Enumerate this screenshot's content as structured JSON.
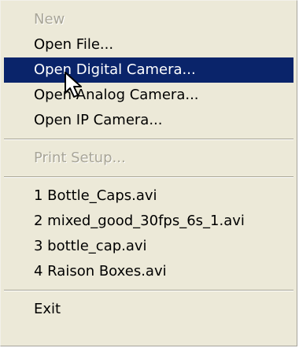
{
  "menu": {
    "items": [
      {
        "label": "New",
        "enabled": false
      },
      {
        "label": "Open File...",
        "enabled": true
      },
      {
        "label": "Open Digital Camera...",
        "enabled": true,
        "highlighted": true
      },
      {
        "label": "Open Analog Camera...",
        "enabled": true
      },
      {
        "label": "Open IP Camera...",
        "enabled": true
      },
      {
        "label": "Print Setup...",
        "enabled": false
      },
      {
        "label": "1 Bottle_Caps.avi",
        "enabled": true
      },
      {
        "label": "2 mixed_good_30fps_6s_1.avi",
        "enabled": true
      },
      {
        "label": "3 bottle_cap.avi",
        "enabled": true
      },
      {
        "label": "4 Raison Boxes.avi",
        "enabled": true
      },
      {
        "label": "Exit",
        "enabled": true
      }
    ]
  },
  "colors": {
    "menu_background": "#ece9d8",
    "highlight": "#0a246a",
    "disabled_text": "#a8a597"
  },
  "cursor": {
    "icon": "arrow-pointer-icon"
  }
}
